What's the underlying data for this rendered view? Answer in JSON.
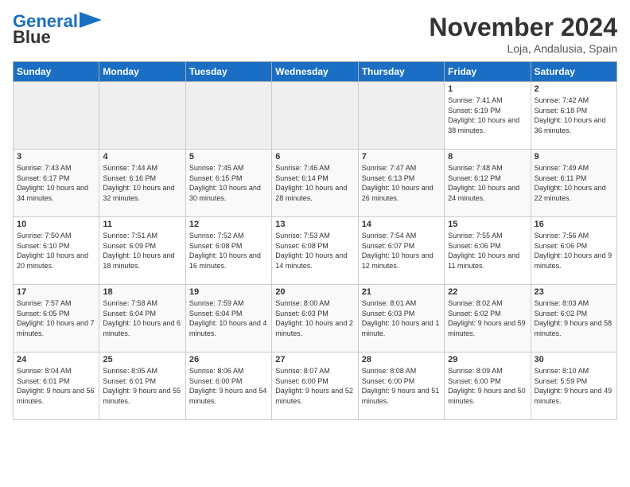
{
  "header": {
    "logo_line1": "General",
    "logo_line2": "Blue",
    "month": "November 2024",
    "location": "Loja, Andalusia, Spain"
  },
  "days_of_week": [
    "Sunday",
    "Monday",
    "Tuesday",
    "Wednesday",
    "Thursday",
    "Friday",
    "Saturday"
  ],
  "weeks": [
    [
      {
        "day": "",
        "info": ""
      },
      {
        "day": "",
        "info": ""
      },
      {
        "day": "",
        "info": ""
      },
      {
        "day": "",
        "info": ""
      },
      {
        "day": "",
        "info": ""
      },
      {
        "day": "1",
        "info": "Sunrise: 7:41 AM\nSunset: 6:19 PM\nDaylight: 10 hours and 38 minutes."
      },
      {
        "day": "2",
        "info": "Sunrise: 7:42 AM\nSunset: 6:18 PM\nDaylight: 10 hours and 36 minutes."
      }
    ],
    [
      {
        "day": "3",
        "info": "Sunrise: 7:43 AM\nSunset: 6:17 PM\nDaylight: 10 hours and 34 minutes."
      },
      {
        "day": "4",
        "info": "Sunrise: 7:44 AM\nSunset: 6:16 PM\nDaylight: 10 hours and 32 minutes."
      },
      {
        "day": "5",
        "info": "Sunrise: 7:45 AM\nSunset: 6:15 PM\nDaylight: 10 hours and 30 minutes."
      },
      {
        "day": "6",
        "info": "Sunrise: 7:46 AM\nSunset: 6:14 PM\nDaylight: 10 hours and 28 minutes."
      },
      {
        "day": "7",
        "info": "Sunrise: 7:47 AM\nSunset: 6:13 PM\nDaylight: 10 hours and 26 minutes."
      },
      {
        "day": "8",
        "info": "Sunrise: 7:48 AM\nSunset: 6:12 PM\nDaylight: 10 hours and 24 minutes."
      },
      {
        "day": "9",
        "info": "Sunrise: 7:49 AM\nSunset: 6:11 PM\nDaylight: 10 hours and 22 minutes."
      }
    ],
    [
      {
        "day": "10",
        "info": "Sunrise: 7:50 AM\nSunset: 6:10 PM\nDaylight: 10 hours and 20 minutes."
      },
      {
        "day": "11",
        "info": "Sunrise: 7:51 AM\nSunset: 6:09 PM\nDaylight: 10 hours and 18 minutes."
      },
      {
        "day": "12",
        "info": "Sunrise: 7:52 AM\nSunset: 6:08 PM\nDaylight: 10 hours and 16 minutes."
      },
      {
        "day": "13",
        "info": "Sunrise: 7:53 AM\nSunset: 6:08 PM\nDaylight: 10 hours and 14 minutes."
      },
      {
        "day": "14",
        "info": "Sunrise: 7:54 AM\nSunset: 6:07 PM\nDaylight: 10 hours and 12 minutes."
      },
      {
        "day": "15",
        "info": "Sunrise: 7:55 AM\nSunset: 6:06 PM\nDaylight: 10 hours and 11 minutes."
      },
      {
        "day": "16",
        "info": "Sunrise: 7:56 AM\nSunset: 6:06 PM\nDaylight: 10 hours and 9 minutes."
      }
    ],
    [
      {
        "day": "17",
        "info": "Sunrise: 7:57 AM\nSunset: 6:05 PM\nDaylight: 10 hours and 7 minutes."
      },
      {
        "day": "18",
        "info": "Sunrise: 7:58 AM\nSunset: 6:04 PM\nDaylight: 10 hours and 6 minutes."
      },
      {
        "day": "19",
        "info": "Sunrise: 7:59 AM\nSunset: 6:04 PM\nDaylight: 10 hours and 4 minutes."
      },
      {
        "day": "20",
        "info": "Sunrise: 8:00 AM\nSunset: 6:03 PM\nDaylight: 10 hours and 2 minutes."
      },
      {
        "day": "21",
        "info": "Sunrise: 8:01 AM\nSunset: 6:03 PM\nDaylight: 10 hours and 1 minute."
      },
      {
        "day": "22",
        "info": "Sunrise: 8:02 AM\nSunset: 6:02 PM\nDaylight: 9 hours and 59 minutes."
      },
      {
        "day": "23",
        "info": "Sunrise: 8:03 AM\nSunset: 6:02 PM\nDaylight: 9 hours and 58 minutes."
      }
    ],
    [
      {
        "day": "24",
        "info": "Sunrise: 8:04 AM\nSunset: 6:01 PM\nDaylight: 9 hours and 56 minutes."
      },
      {
        "day": "25",
        "info": "Sunrise: 8:05 AM\nSunset: 6:01 PM\nDaylight: 9 hours and 55 minutes."
      },
      {
        "day": "26",
        "info": "Sunrise: 8:06 AM\nSunset: 6:00 PM\nDaylight: 9 hours and 54 minutes."
      },
      {
        "day": "27",
        "info": "Sunrise: 8:07 AM\nSunset: 6:00 PM\nDaylight: 9 hours and 52 minutes."
      },
      {
        "day": "28",
        "info": "Sunrise: 8:08 AM\nSunset: 6:00 PM\nDaylight: 9 hours and 51 minutes."
      },
      {
        "day": "29",
        "info": "Sunrise: 8:09 AM\nSunset: 6:00 PM\nDaylight: 9 hours and 50 minutes."
      },
      {
        "day": "30",
        "info": "Sunrise: 8:10 AM\nSunset: 5:59 PM\nDaylight: 9 hours and 49 minutes."
      }
    ]
  ]
}
